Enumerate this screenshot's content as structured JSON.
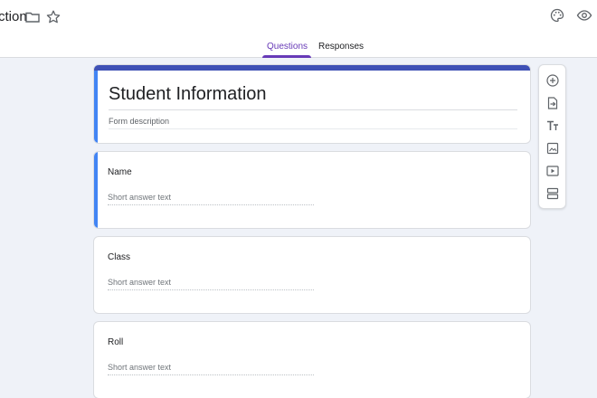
{
  "header": {
    "doc_title": "ction",
    "icons": [
      "folder-icon",
      "star-icon",
      "palette-icon",
      "eye-icon"
    ]
  },
  "tabs": [
    {
      "label": "Questions",
      "active": true
    },
    {
      "label": "Responses",
      "active": false
    }
  ],
  "form": {
    "title": "Student Information",
    "description_placeholder": "Form description"
  },
  "questions": [
    {
      "title": "Name",
      "hint": "Short answer text"
    },
    {
      "title": "Class",
      "hint": "Short answer text"
    },
    {
      "title": "Roll",
      "hint": "Short answer text"
    }
  ],
  "toolbar": {
    "icons": [
      "add-question-icon",
      "import-questions-icon",
      "add-title-icon",
      "add-image-icon",
      "add-video-icon",
      "add-section-icon"
    ]
  },
  "colors": {
    "accent": "#673ab7",
    "header_band": "#3f51b5",
    "active_indicator": "#4285f4",
    "background": "#eff2f8"
  }
}
